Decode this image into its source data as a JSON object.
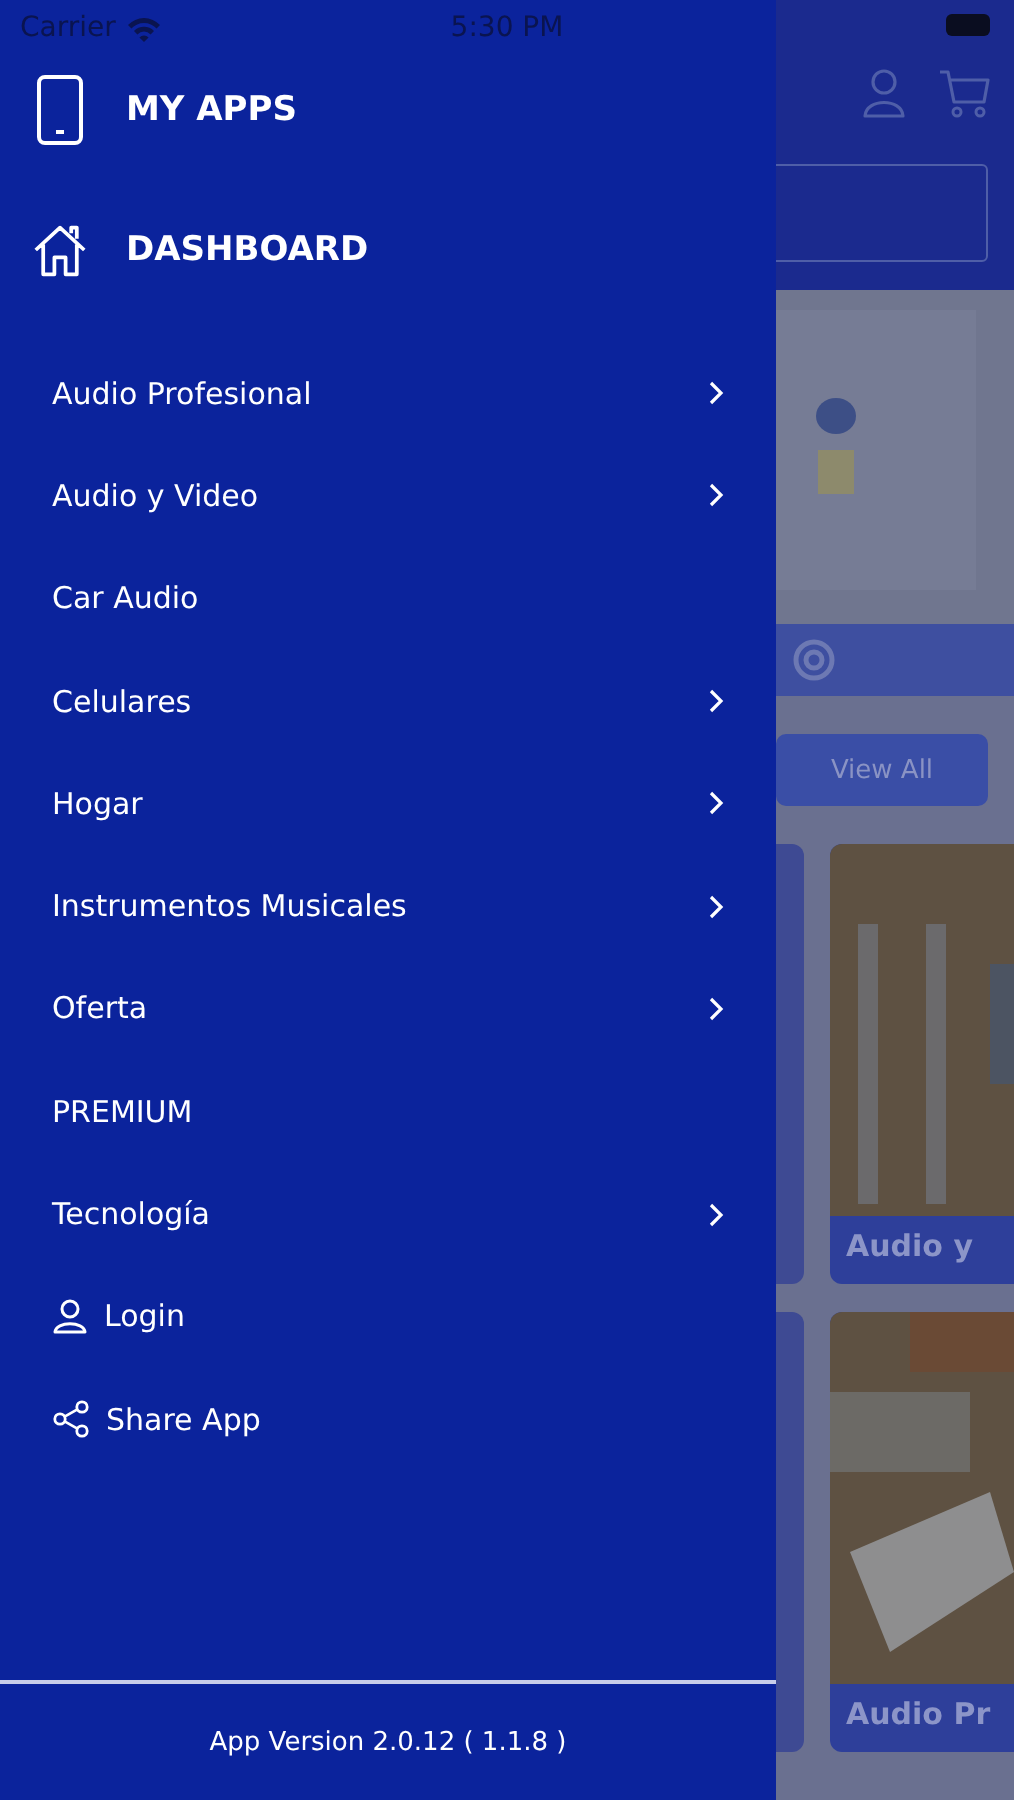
{
  "status_bar": {
    "carrier": "Carrier",
    "time": "5:30 PM"
  },
  "drawer": {
    "header_items": [
      {
        "label": "MY APPS",
        "kind": "phone"
      },
      {
        "label": "DASHBOARD",
        "kind": "home"
      }
    ],
    "items": [
      {
        "label": "Audio Profesional",
        "kind": "category",
        "expandable": true
      },
      {
        "label": "Audio y Video",
        "kind": "category",
        "expandable": true
      },
      {
        "label": "Car Audio",
        "kind": "category",
        "expandable": false
      },
      {
        "label": "Celulares",
        "kind": "category",
        "expandable": true
      },
      {
        "label": "Hogar",
        "kind": "category",
        "expandable": true
      },
      {
        "label": "Instrumentos Musicales",
        "kind": "category",
        "expandable": true
      },
      {
        "label": "Oferta",
        "kind": "category",
        "expandable": true
      },
      {
        "label": "PREMIUM",
        "kind": "category",
        "expandable": false
      },
      {
        "label": "Tecnología",
        "kind": "category",
        "expandable": true
      },
      {
        "label": "Login",
        "kind": "login",
        "expandable": false
      },
      {
        "label": "Share App",
        "kind": "share",
        "expandable": false
      }
    ],
    "footer": "App Version 2.0.12 ( 1.1.8 )"
  },
  "background_page": {
    "view_all": "View All",
    "cards": [
      {
        "title": "Audio y"
      },
      {
        "title": "Audio Pr"
      }
    ]
  }
}
